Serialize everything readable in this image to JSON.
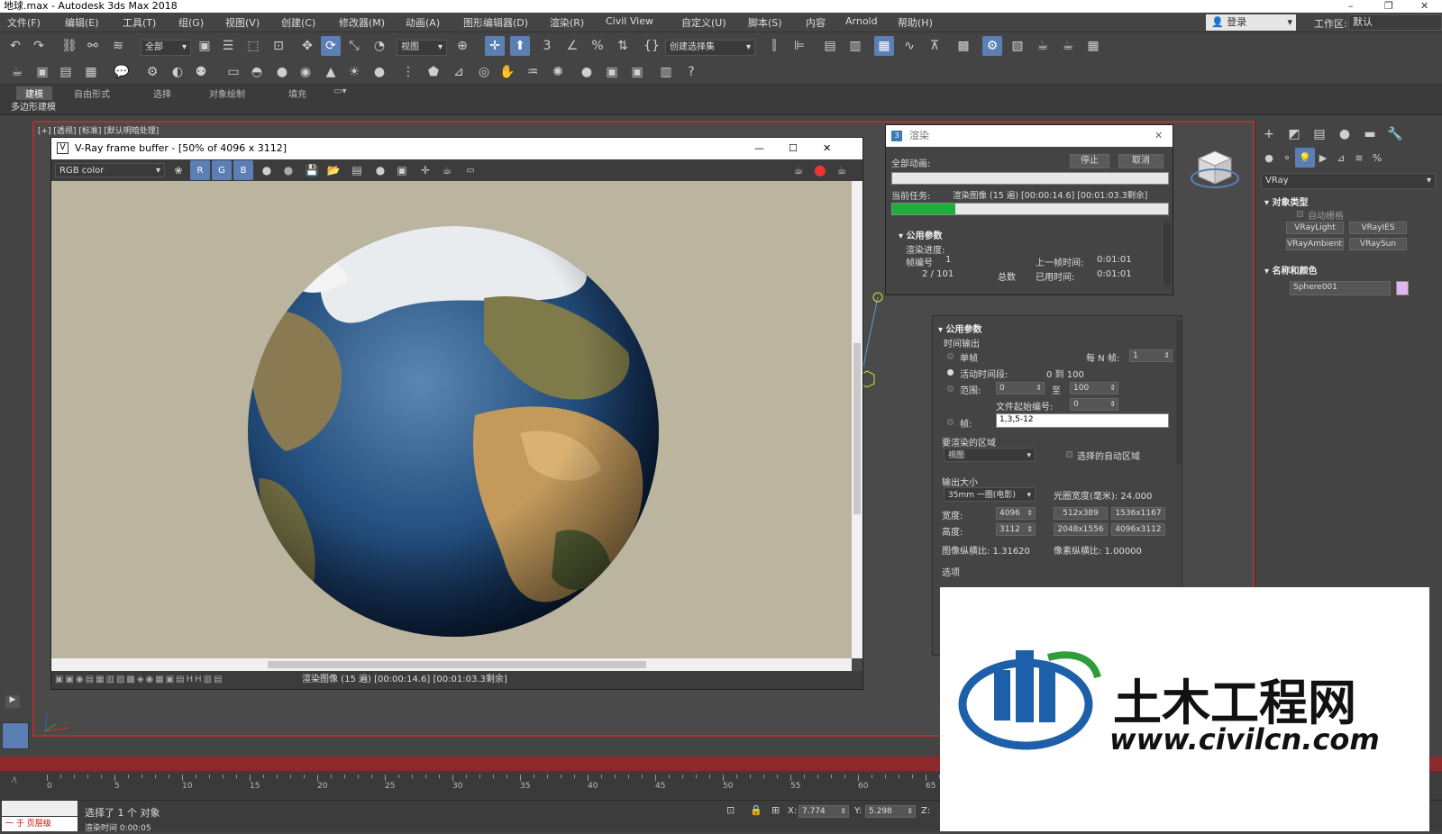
{
  "window": {
    "title": "地球.max - Autodesk 3ds Max 2018",
    "controls": [
      "–",
      "❐",
      "✕"
    ]
  },
  "menubar": {
    "items": [
      "文件(F)",
      "编辑(E)",
      "工具(T)",
      "组(G)",
      "视图(V)",
      "创建(C)",
      "修改器(M)",
      "动画(A)",
      "图形编辑器(D)",
      "渲染(R)",
      "Civil View",
      "自定义(U)",
      "脚本(S)",
      "内容",
      "Arnold",
      "帮助(H)"
    ],
    "login": "登录",
    "workspace_label": "工作区:",
    "workspace_value": "默认"
  },
  "toolbar": {
    "selection_filter": "全部",
    "ref_coord": "视图",
    "named_selection": "创建选择集"
  },
  "ribbon": {
    "tabs": [
      "建模",
      "自由形式",
      "选择",
      "对象绘制",
      "填充"
    ],
    "sub": "多边形建模"
  },
  "viewport": {
    "label": "[+] [透视] [标准] [默认明暗处理]"
  },
  "vfb": {
    "title": "V-Ray frame buffer - [50% of 4096 x 3112]",
    "channel": "RGB color",
    "status": "渲染图像 (15 遍) [00:00:14.6] [00:01:03.3剩余]"
  },
  "render_dialog": {
    "title": "渲染",
    "all_anim_label": "全部动画:",
    "stop": "停止",
    "cancel": "取消",
    "current_task_label": "当前任务:",
    "current_task": "渲染图像 (15 遍) [00:00:14.6] [00:01:03.3剩余]",
    "progress_pct": 23,
    "section": "公用参数",
    "render_progress": "渲染进度:",
    "frame_no_label": "帧编号",
    "frame_no": "1",
    "last_frame_label": "上一帧时间:",
    "last_frame": "0:01:01",
    "frames": "2 / 101",
    "total_label": "总数",
    "elapsed_label": "已用时间:",
    "elapsed": "0:01:01"
  },
  "render_setup": {
    "section": "公用参数",
    "time_output": "时间输出",
    "single": "单帧",
    "every_n": "每 N 帧:",
    "every_n_val": "1",
    "active_seg": "活动时间段:",
    "active_range": "0 到 100",
    "range": "范围:",
    "range_from": "0",
    "range_to_label": "至",
    "range_to": "100",
    "file_start": "文件起始编号:",
    "file_start_val": "0",
    "frames_label": "帧:",
    "frames_val": "1,3,5-12",
    "area": "要渲染的区域",
    "area_val": "视图",
    "auto_region": "选择的自动区域",
    "output_size": "输出大小",
    "film": "35mm 一圈(电影)",
    "aperture": "光圈宽度(毫米): 24.000",
    "width_label": "宽度:",
    "width": "4096",
    "height_label": "高度:",
    "height": "3112",
    "presets": [
      "512x389",
      "1536x1167",
      "2048x1556",
      "4096x3112"
    ],
    "aspect": "图像纵横比: 1.31620",
    "pixel_aspect": "像素纵横比: 1.00000",
    "options": "选项"
  },
  "cmdpanel": {
    "renderer": "VRay",
    "object_type": "对象类型",
    "autogrid": "自动栅格",
    "buttons": [
      "VRayLight",
      "VRayIES",
      "VRayAmbientLight",
      "VRaySun"
    ],
    "name_color": "名称和颜色",
    "object_name": "Sphere001",
    "object_color": "#e0b5f0"
  },
  "timeline": {
    "ticks": [
      "0",
      "5",
      "10",
      "15",
      "20",
      "25",
      "30",
      "35",
      "40",
      "45",
      "50",
      "55",
      "60",
      "65"
    ]
  },
  "status": {
    "selected": "选择了 1 个 对象",
    "render_time": "渲染时间  0:00:05",
    "level": "一  于 页层级",
    "x_label": "X:",
    "x": "7.774",
    "y_label": "Y:",
    "y": "5.298",
    "z_label": "Z:"
  },
  "watermark": {
    "cn": "土木工程网",
    "url": "www.civilcn.com"
  }
}
